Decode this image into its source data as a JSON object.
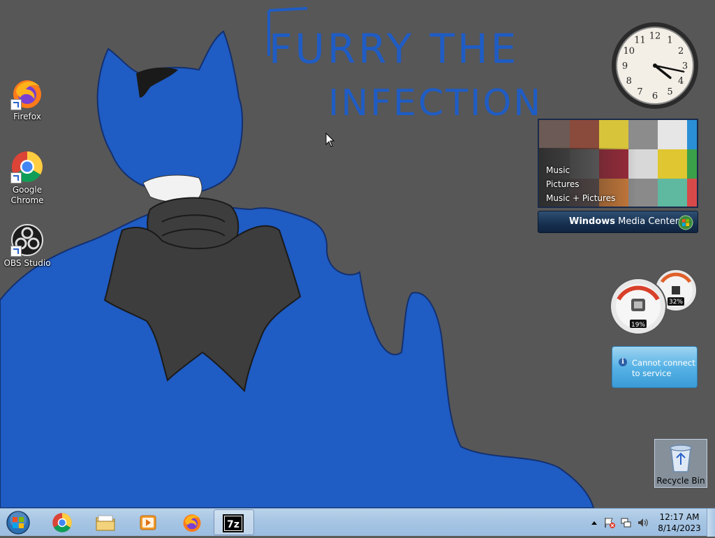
{
  "desktop": {
    "wallpaper_text_line1": "FURRY THE",
    "wallpaper_text_line2": "INFECTION",
    "icons": [
      {
        "label": "Firefox",
        "icon": "firefox-icon"
      },
      {
        "label": "Google Chrome",
        "icon": "chrome-icon"
      },
      {
        "label": "OBS Studio",
        "icon": "obs-icon"
      }
    ],
    "recycle_bin": {
      "label": "Recycle Bin",
      "icon": "recycle-bin-icon"
    }
  },
  "gadgets": {
    "clock": {
      "hour": 4,
      "minute": 17,
      "numerals": [
        "12",
        "1",
        "2",
        "3",
        "4",
        "5",
        "6",
        "7",
        "8",
        "9",
        "10",
        "11"
      ]
    },
    "media_center": {
      "menu": [
        "Music",
        "Pictures",
        "Music + Pictures"
      ],
      "brand_bold": "Windows",
      "brand_rest": " Media Center"
    },
    "cpu_meter": {
      "cpu_percent": "19%",
      "memory_percent": "32%"
    },
    "weather": {
      "message": "Cannot connect to service"
    }
  },
  "taskbar": {
    "start_icon": "windows-start-icon",
    "pinned": [
      {
        "name": "chrome",
        "icon": "chrome-icon"
      },
      {
        "name": "explorer",
        "icon": "folder-icon"
      },
      {
        "name": "media-player",
        "icon": "media-player-icon"
      },
      {
        "name": "firefox",
        "icon": "firefox-icon"
      },
      {
        "name": "7zip",
        "icon": "7zip-icon",
        "label": "7z",
        "active": true
      }
    ],
    "tray": {
      "time": "12:17 AM",
      "date": "8/14/2023"
    }
  },
  "colors": {
    "wallpaper_bg": "#575757",
    "ink_blue": "#1f5cc4",
    "taskbar": "#a7c5e3"
  }
}
